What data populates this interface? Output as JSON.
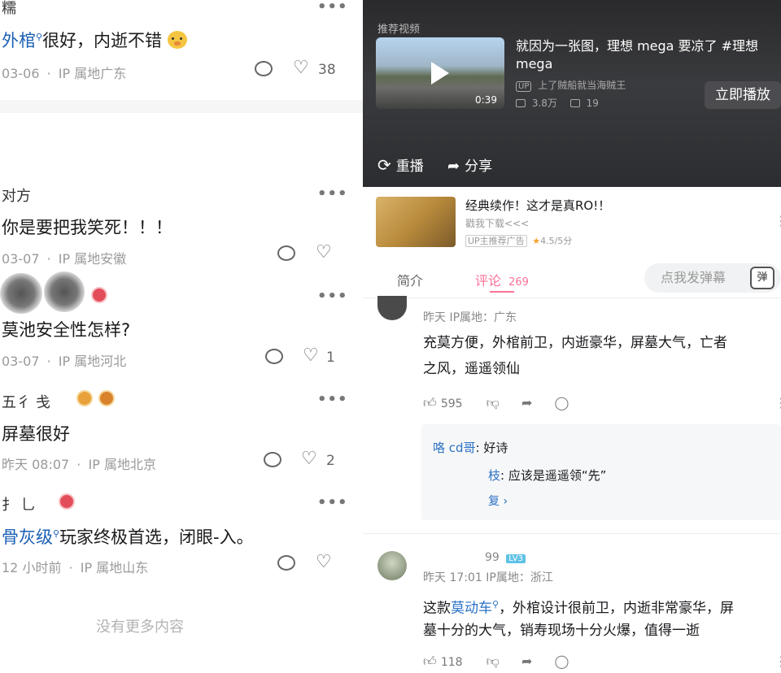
{
  "left": {
    "comments": [
      {
        "name": "糯",
        "text_kw": "外棺",
        "text_rest": "很好，内逝不错",
        "emoji": "bear-face",
        "date": "03-06",
        "ip": "IP 属地广东",
        "likes": "38"
      },
      {
        "name": "对方",
        "text": "你是要把我笑死！！！",
        "date": "03-07",
        "ip": "IP 属地安徽",
        "likes": ""
      },
      {
        "name": "",
        "text": "莫池安全性怎样?",
        "date": "03-07",
        "ip": "IP 属地河北",
        "likes": "1"
      },
      {
        "name": "五彳 戋",
        "text": "屏墓很好",
        "date": "昨天 08:07",
        "ip": "IP 属地北京",
        "likes": "2"
      },
      {
        "name": "扌 乚",
        "text_kw": "骨灰级",
        "text_rest": "玩家终极首选，闭眼-入。",
        "date": "12 小时前",
        "ip": "IP 属地山东",
        "likes": ""
      }
    ],
    "no_more": "没有更多内容",
    "dot": "·",
    "more": "•••"
  },
  "right": {
    "video": {
      "section": "推荐视频",
      "title": "就因为一张图，理想 mega 要凉了 #理想 mega",
      "up_tag": "UP",
      "uploader": "上了贼船就当海贼王",
      "duration": "0:39",
      "views": "3.8万",
      "danmaku": "19",
      "play_now": "立即播放",
      "replay": "重播",
      "share": "分享"
    },
    "ad": {
      "title": "经典续作！这才是真RO!！",
      "subtitle": "戳我下载<<<",
      "tag": "UP主推荐广告",
      "rating": "4.5/5分"
    },
    "tabs": {
      "intro": "简介",
      "comments": "评论",
      "comment_count": "269",
      "danmu_placeholder": "点我发弹幕",
      "danmu_icon": "弹"
    },
    "comments": [
      {
        "meta": "昨天 IP属地：广东",
        "text_line1": "充莫方便，外棺前卫，内逝豪华，屏墓大气，亡者",
        "text_line2": "之风，遥遥领仙",
        "likes": "595",
        "replies": [
          {
            "name": "咯 cd哥",
            "text": ": 好诗"
          },
          {
            "name": "枝",
            "text": ": 应该是遥遥领“先”"
          }
        ],
        "more_replies": "复"
      },
      {
        "name": "99",
        "level": "LV3",
        "meta": "昨天 17:01 IP属地：浙江",
        "text_pre": "这款",
        "text_kw": "莫动车",
        "text_line1_rest": "，外棺设计很前卫，内逝非常豪华，屏",
        "text_line2": "墓十分的大气，销寿现场十分火爆，值得一逝",
        "likes": "118"
      }
    ]
  }
}
